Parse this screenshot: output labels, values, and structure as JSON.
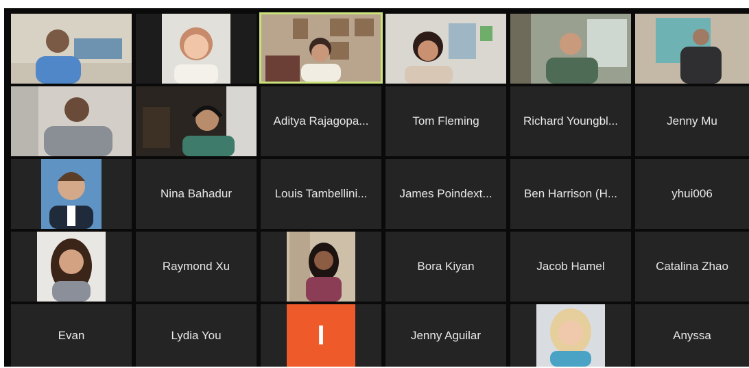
{
  "app": "Zoom gallery view",
  "colors": {
    "active_speaker_border": "#c9e27a",
    "avatar_bg": "#ef5a2a",
    "tile_bg": "#242424"
  },
  "participants": [
    {
      "name": "Participant (video)",
      "kind": "video"
    },
    {
      "name": "Participant (video)",
      "kind": "video"
    },
    {
      "name": "Participant (video, active speaker)",
      "kind": "video"
    },
    {
      "name": "Participant (video)",
      "kind": "video"
    },
    {
      "name": "Participant (video)",
      "kind": "video"
    },
    {
      "name": "Participant (video)",
      "kind": "video"
    },
    {
      "name": "Participant (video)",
      "kind": "video"
    },
    {
      "name": "Participant (video)",
      "kind": "video"
    },
    {
      "name": "Aditya Rajagopa...",
      "kind": "name"
    },
    {
      "name": "Tom Fleming",
      "kind": "name"
    },
    {
      "name": "Richard Youngbl...",
      "kind": "name"
    },
    {
      "name": "Jenny Mu",
      "kind": "name"
    },
    {
      "name": "Profile photo",
      "kind": "photo"
    },
    {
      "name": "Nina Bahadur",
      "kind": "name"
    },
    {
      "name": "Louis Tambellini...",
      "kind": "name"
    },
    {
      "name": "James Poindext...",
      "kind": "name"
    },
    {
      "name": "Ben Harrison (H...",
      "kind": "name"
    },
    {
      "name": "yhui006",
      "kind": "name"
    },
    {
      "name": "Profile photo",
      "kind": "photo"
    },
    {
      "name": "Raymond Xu",
      "kind": "name"
    },
    {
      "name": "Profile photo",
      "kind": "photo"
    },
    {
      "name": "Bora Kiyan",
      "kind": "name"
    },
    {
      "name": "Jacob Hamel",
      "kind": "name"
    },
    {
      "name": "Catalina Zhao",
      "kind": "name"
    },
    {
      "name": "Evan",
      "kind": "name"
    },
    {
      "name": "Lydia You",
      "kind": "name"
    },
    {
      "name": "Avatar",
      "kind": "avatar",
      "initial": "I"
    },
    {
      "name": "Jenny Aguilar",
      "kind": "name"
    },
    {
      "name": "Profile photo",
      "kind": "photo"
    },
    {
      "name": "Anyssa",
      "kind": "name"
    }
  ]
}
